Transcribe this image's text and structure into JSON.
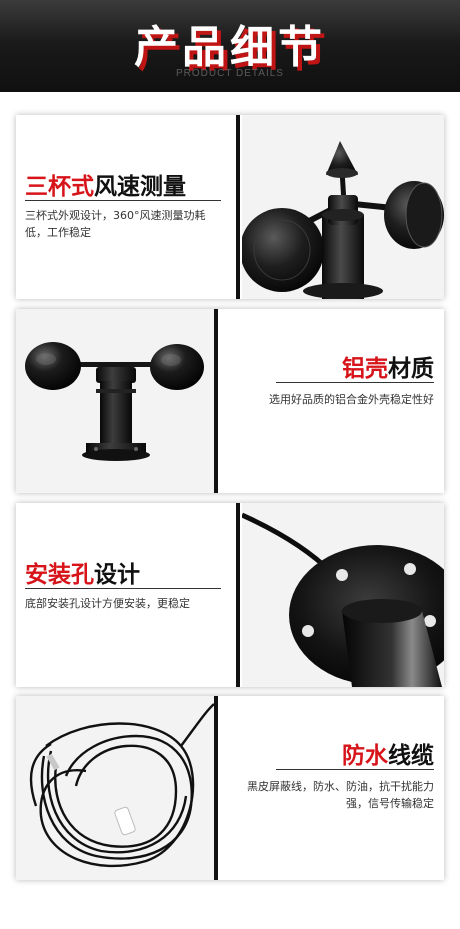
{
  "banner": {
    "title": "产品细节",
    "subtitle": "PRODUCT DETAILS"
  },
  "features": [
    {
      "heading_red": "三杯式",
      "heading_dark": "风速测量",
      "description": "三杯式外观设计，360°风速测量功耗低，工作稳定"
    },
    {
      "heading_red": "铝壳",
      "heading_dark": "材质",
      "description": "选用好品质的铝合金外壳稳定性好"
    },
    {
      "heading_red": "安装孔",
      "heading_dark": "设计",
      "description": "底部安装孔设计方便安装，更稳定"
    },
    {
      "heading_red": "防水",
      "heading_dark": "线缆",
      "description": "黑皮屏蔽线，防水、防油，抗干扰能力强，信号传输稳定"
    }
  ],
  "colors": {
    "accent": "#d6141a",
    "banner_bg": "#1a1a1a",
    "text": "#222222"
  }
}
